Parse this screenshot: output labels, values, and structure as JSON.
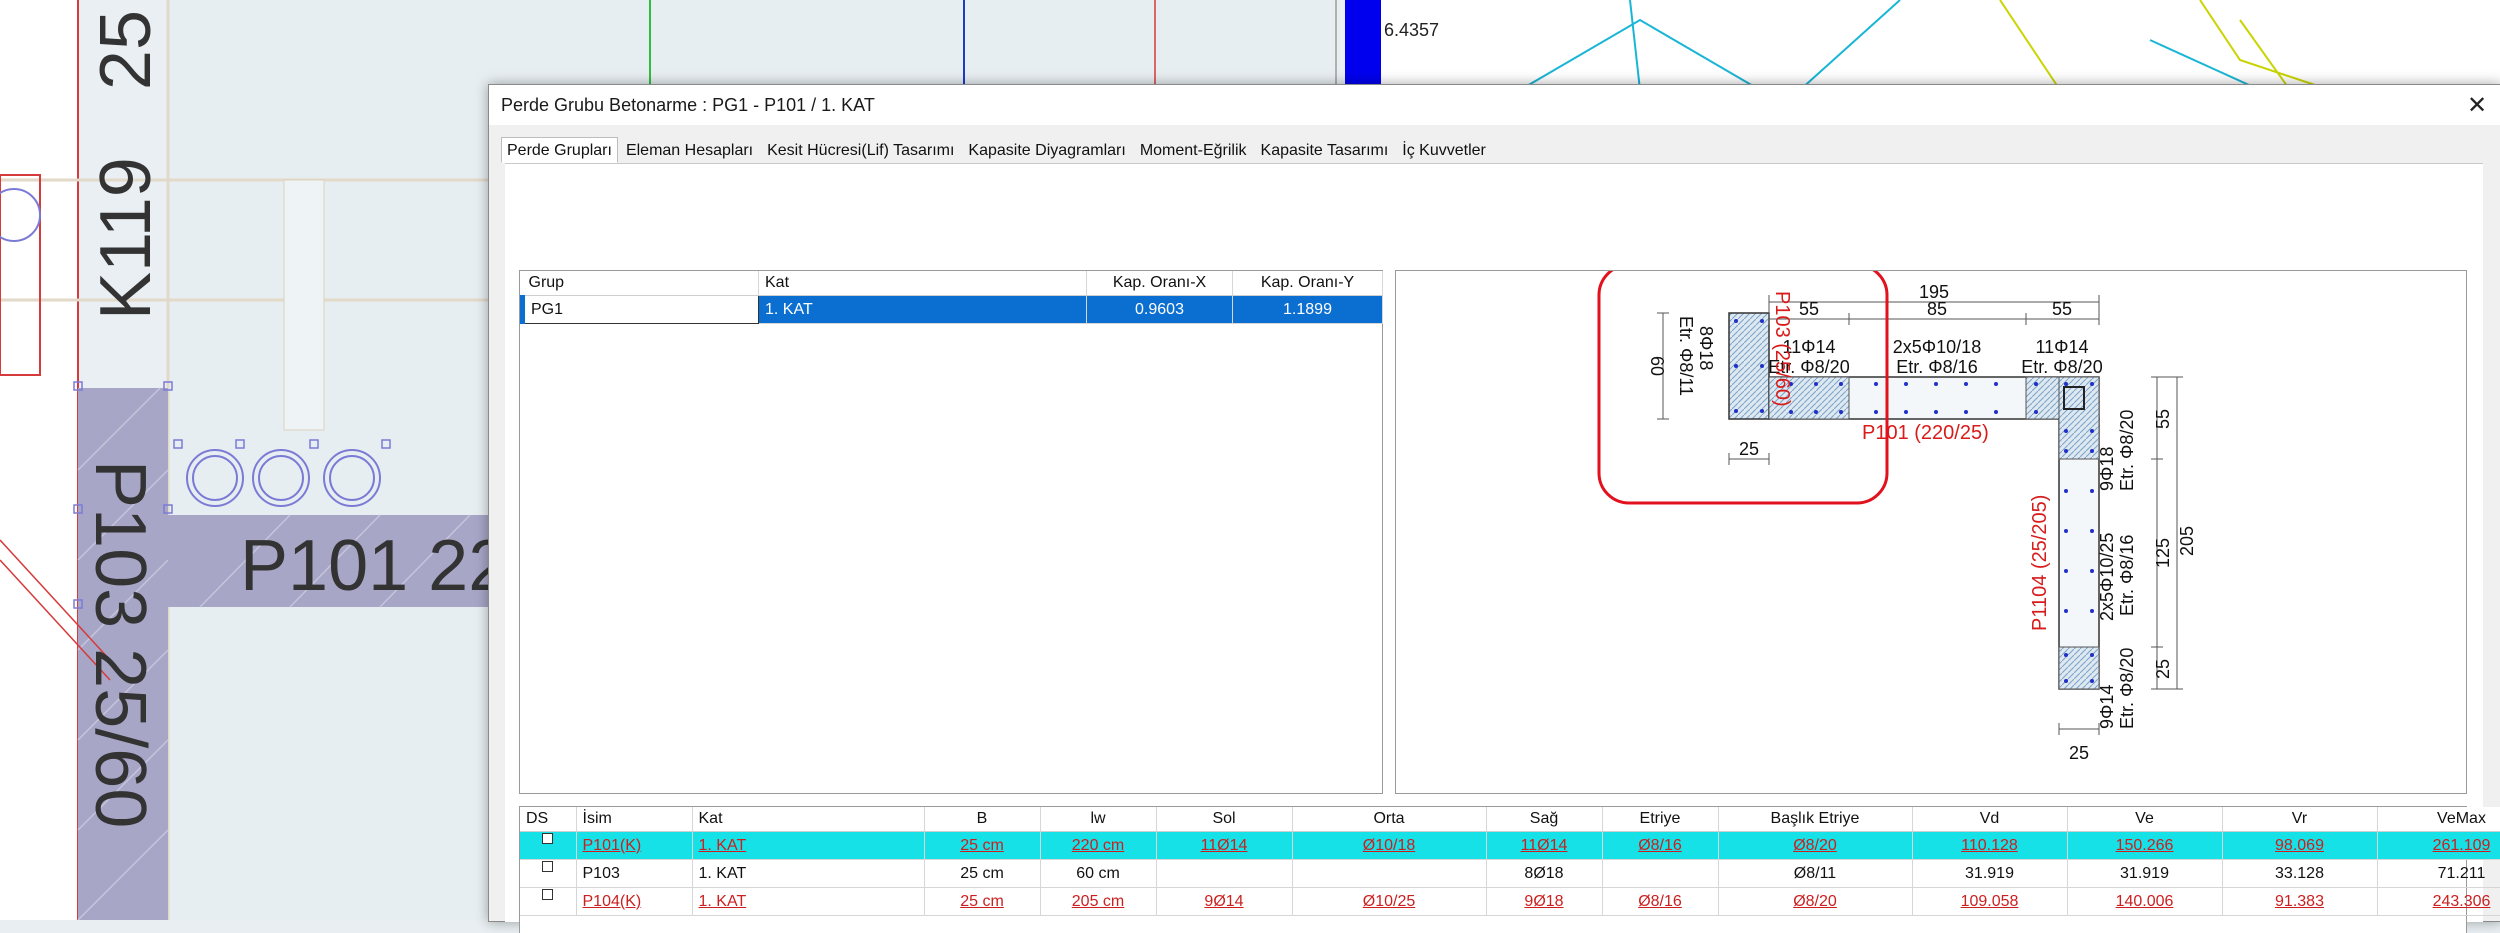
{
  "background": {
    "labels": {
      "k119": "K119",
      "n25": "25",
      "p103": "P103 25/60",
      "p101": "P101 22",
      "value": "6.4357"
    }
  },
  "dialog": {
    "title": "Perde Grubu Betonarme  :  PG1 - P101 / 1. KAT",
    "close_label": "✕",
    "tabs": [
      "Perde Grupları",
      "Eleman Hesapları",
      "Kesit Hücresi(Lif) Tasarımı",
      "Kapasite Diyagramları",
      "Moment-Eğrilik",
      "Kapasite Tasarımı",
      "İç Kuvvetler"
    ],
    "active_tab": "Perde Grupları"
  },
  "group_table": {
    "columns": [
      "Grup",
      "Kat",
      "Kap. Oranı-X",
      "Kap. Oranı-Y"
    ],
    "rows": [
      [
        "PG1",
        "1. KAT",
        "0.9603",
        "1.1899"
      ]
    ]
  },
  "drawing": {
    "p103_label": "P103 (25/60)",
    "p103_rebar": "8Φ18",
    "p103_stirrup": "Etr. Φ8/11",
    "p103_height": "60",
    "p103_width": "25",
    "p101_label": "P101 (220/25)",
    "dim_total": "195",
    "dim_left": "55",
    "dim_mid": "85",
    "dim_right": "55",
    "left_rebar": "11Φ14",
    "left_stirrup": "Etr. Φ8/20",
    "mid_rebar": "2x5Φ10/18",
    "mid_stirrup": "Etr. Φ8/16",
    "right_rebar": "11Φ14",
    "right_stirrup": "Etr. Φ8/20",
    "p104_label": "P1104 (25/205)",
    "p104_top_rebar": "9Φ18",
    "p104_top_stirrup": "Etr. Φ8/20",
    "p104_mid_rebar": "2x5Φ10/25",
    "p104_mid_stirrup": "Etr. Φ8/16",
    "p104_bot_rebar": "9Φ14",
    "p104_bot_stirrup": "Etr. Φ8/20",
    "dim_v_total": "205",
    "dim_v_top": "55",
    "dim_v_mid": "125",
    "dim_v_bot": "25",
    "dim_p104_width": "25"
  },
  "elements_table": {
    "columns": [
      "DS",
      "İsim",
      "Kat",
      "B",
      "lw",
      "Sol",
      "Orta",
      "Sağ",
      "Etriye",
      "Başlık Etriye",
      "Vd",
      "Ve",
      "Vr",
      "VeMax"
    ],
    "rows": [
      [
        "",
        "P101(K)",
        "1. KAT",
        "25 cm",
        "220 cm",
        "11Ø14",
        "Ø10/18",
        "11Ø14",
        "Ø8/16",
        "Ø8/20",
        "110.128",
        "150.266",
        "98.069",
        "261.109"
      ],
      [
        "",
        "P103",
        "1. KAT",
        "25 cm",
        "60 cm",
        "",
        "",
        "8Ø18",
        "",
        "Ø8/11",
        "31.919",
        "31.919",
        "33.128",
        "71.211"
      ],
      [
        "",
        "P104(K)",
        "1. KAT",
        "25 cm",
        "205 cm",
        "9Ø14",
        "Ø10/25",
        "9Ø18",
        "Ø8/16",
        "Ø8/20",
        "109.058",
        "140.006",
        "91.383",
        "243.306"
      ]
    ],
    "row_styles": [
      "selected-red",
      "normal",
      "red"
    ]
  },
  "colors": {
    "selection": "#0b6fd1",
    "row_highlight": "#16e1e6",
    "warning_red": "#cc1f1f",
    "callout": "#e2111e"
  }
}
